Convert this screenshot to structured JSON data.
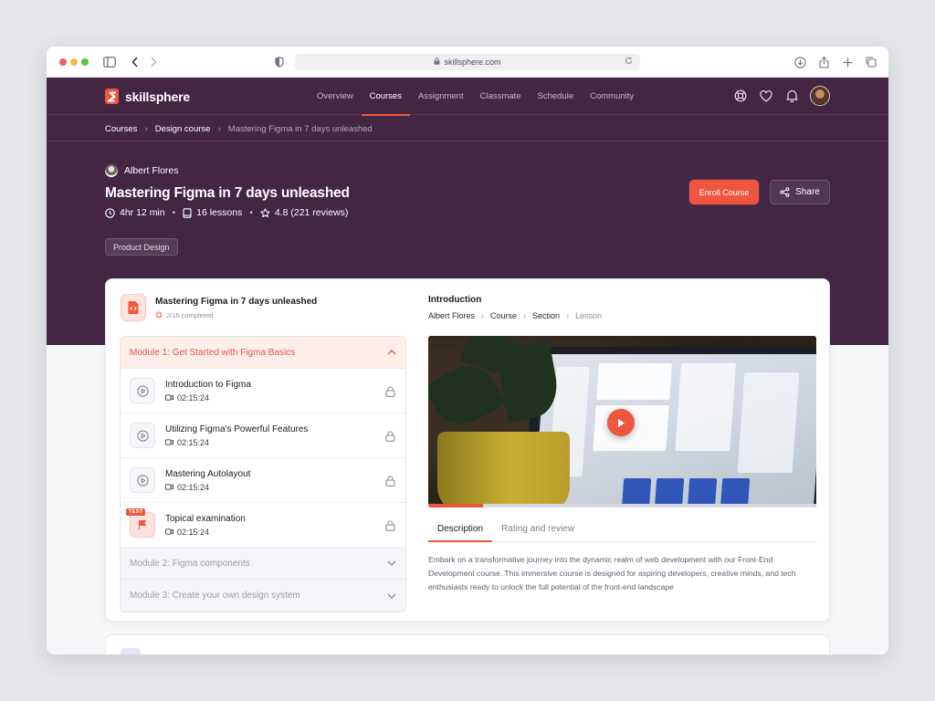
{
  "browser": {
    "url": "skillsphere.com"
  },
  "brand": {
    "name": "skillsphere",
    "accent_color": "#f0563f",
    "header_color": "#442642"
  },
  "nav": {
    "links": [
      "Overview",
      "Courses",
      "Assignment",
      "Classmate",
      "Schedule",
      "Community"
    ],
    "active": "Courses",
    "icons": [
      "support-icon",
      "heart-icon",
      "bell-icon",
      "user-avatar"
    ]
  },
  "breadcrumb": {
    "items": [
      "Courses",
      "Design course",
      "Mastering Figma in 7 days unleashed"
    ]
  },
  "course": {
    "author": "Albert Flores",
    "title": "Mastering Figma in 7 days unleashed",
    "duration": "4hr 12 min",
    "lessons": "16 lessons",
    "rating": "4.8 (221 reviews)",
    "tag": "Product Design",
    "enroll_label": "Enroll Course",
    "share_label": "Share"
  },
  "sidebar": {
    "course_name": "Mastering Figma in 7 days unleashed",
    "progress_text": "2/16 completed",
    "modules": [
      {
        "title": "Module 1: Get Started with Figma Basics",
        "expanded": true
      },
      {
        "title": "Module 2: Figma components",
        "expanded": false
      },
      {
        "title": "Module 3: Create your own design system",
        "expanded": false
      }
    ],
    "lessons": [
      {
        "title": "Introduction to Figma",
        "duration": "02:15:24",
        "type": "video",
        "locked": true
      },
      {
        "title": "Utilizing Figma's Powerful Features",
        "duration": "02:15:24",
        "type": "video",
        "locked": true
      },
      {
        "title": "Mastering Autolayout",
        "duration": "02:15:24",
        "type": "video",
        "locked": true
      },
      {
        "title": "Topical examination",
        "duration": "02:15:24",
        "type": "test",
        "badge": "TEST",
        "locked": true
      }
    ]
  },
  "lesson_view": {
    "heading": "Introduction",
    "crumbs": [
      "Albert Flores",
      "Course",
      "Section",
      "Lesson"
    ],
    "video_progress": 0.14,
    "tabs": [
      "Description",
      "Rating and review"
    ],
    "active_tab": "Description",
    "description": "Embark on a transformative journey into the dynamic realm of web development with our Front-End Development course. This immersive course is designed for aspiring developers, creative minds, and tech enthusiasts ready to unlock the full potential of the front-end landscape"
  }
}
